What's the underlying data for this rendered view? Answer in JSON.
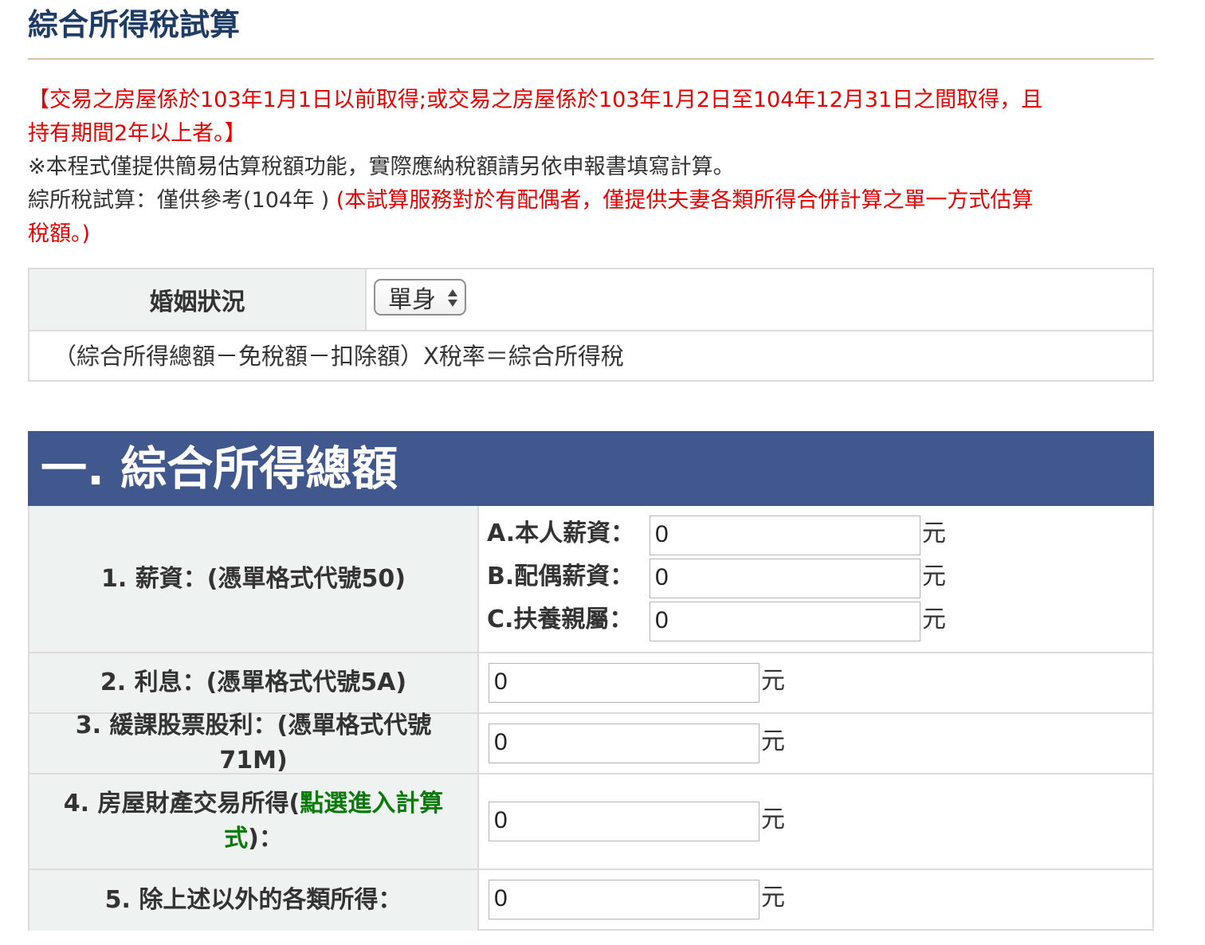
{
  "page_title": "綜合所得稅試算",
  "notice": {
    "line1": "【交易之房屋係於103年1月1日以前取得;或交易之房屋係於103年1月2日至104年12月31日之間取得，且",
    "line2": "持有期間2年以上者。】",
    "line3": "※本程式僅提供簡易估算稅額功能，實際應納稅額請另依申報書填寫計算。",
    "line4_prefix": "綜所稅試算：僅供參考(104年 ) ",
    "line4_red": "(本試算服務對於有配偶者，僅提供夫妻各類所得合併計算之單一方式估算",
    "line5_red": "稅額。)"
  },
  "marital": {
    "label": "婚姻狀況",
    "selected": "單身",
    "formula": "（綜合所得總額－免稅額－扣除額）X稅率＝綜合所得稅"
  },
  "section1": {
    "title": "一. 綜合所得總額",
    "unit": "元",
    "rows": [
      {
        "label": "1. 薪資：(憑單格式代號50)",
        "sub": [
          {
            "label": "A.本人薪資：",
            "value": "0"
          },
          {
            "label": "B.配偶薪資：",
            "value": "0"
          },
          {
            "label": "C.扶養親屬：",
            "value": "0"
          }
        ]
      },
      {
        "label": "2. 利息：(憑單格式代號5A)",
        "value": "0"
      },
      {
        "label": "3. 緩課股票股利：(憑單格式代號71M)",
        "value": "0"
      },
      {
        "label_prefix": "4. 房屋財產交易所得(",
        "label_link": "點選進入計算式",
        "label_suffix": ")：",
        "value": "0"
      },
      {
        "label": "5. 除上述以外的各類所得：",
        "value": "0"
      }
    ]
  },
  "colors": {
    "title": "#1f3c66",
    "notice_red": "#e60000",
    "section_header": "#41588e",
    "label_bg": "#eef3f2",
    "link_green": "#0a7a0a"
  },
  "icons": {
    "select_arrows": "updown-arrows-icon"
  }
}
